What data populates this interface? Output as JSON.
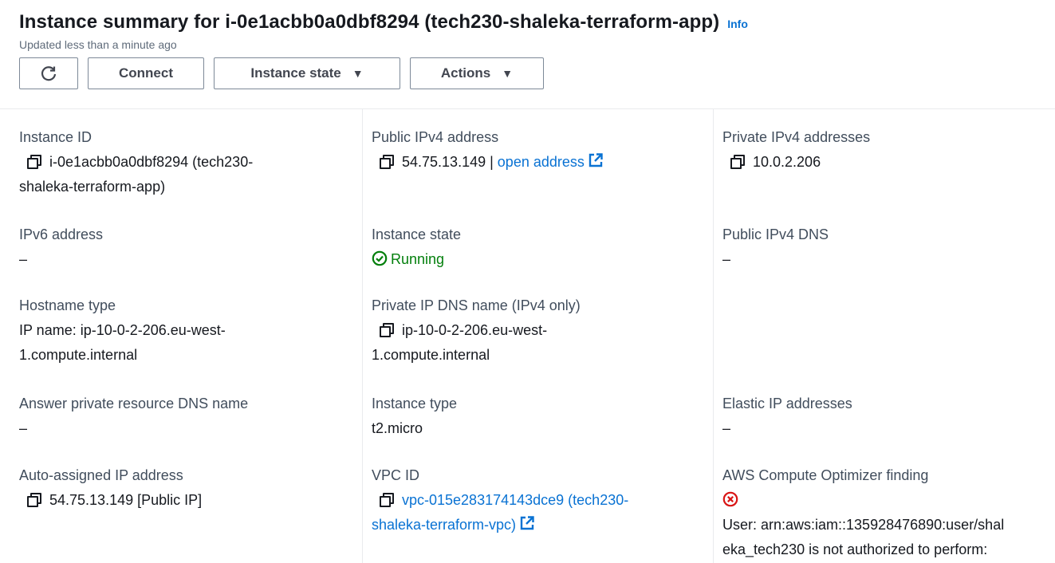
{
  "header": {
    "title": "Instance summary for i-0e1acbb0a0dbf8294 (tech230-shaleka-terraform-app)",
    "info": "Info",
    "updated": "Updated less than a minute ago"
  },
  "toolbar": {
    "refresh_icon": "refresh-icon",
    "connect": "Connect",
    "instance_state": "Instance state",
    "actions": "Actions"
  },
  "details": {
    "instance_id": {
      "label": "Instance ID",
      "line1": "i-0e1acbb0a0dbf8294 (tech230-",
      "line2": "shaleka-terraform-app)"
    },
    "public_ipv4": {
      "label": "Public IPv4 address",
      "value": "54.75.13.149 |",
      "link": "open address"
    },
    "private_ipv4": {
      "label": "Private IPv4 addresses",
      "value": "10.0.2.206"
    },
    "ipv6": {
      "label": "IPv6 address",
      "value": "–"
    },
    "instance_state": {
      "label": "Instance state",
      "value": "Running"
    },
    "public_dns": {
      "label": "Public IPv4 DNS",
      "value": "–"
    },
    "hostname_type": {
      "label": "Hostname type",
      "line1": "IP name: ip-10-0-2-206.eu-west-",
      "line2": "1.compute.internal"
    },
    "private_dns": {
      "label": "Private IP DNS name (IPv4 only)",
      "line1": "ip-10-0-2-206.eu-west-",
      "line2": "1.compute.internal"
    },
    "answer_dns": {
      "label": "Answer private resource DNS name",
      "value": "–"
    },
    "instance_type": {
      "label": "Instance type",
      "value": "t2.micro"
    },
    "elastic_ip": {
      "label": "Elastic IP addresses",
      "value": "–"
    },
    "auto_ip": {
      "label": "Auto-assigned IP address",
      "value": "54.75.13.149 [Public IP]"
    },
    "vpc_id": {
      "label": "VPC ID",
      "line1": "vpc-015e283174143dce9 (tech230-",
      "line2": "shaleka-terraform-vpc)"
    },
    "optimizer": {
      "label": "AWS Compute Optimizer finding",
      "line1": "User: arn:aws:iam::135928476890:user/shal",
      "line2": "eka_tech230 is not authorized to perform:"
    }
  },
  "colors": {
    "link": "#0972d3",
    "success": "#037f0c",
    "error": "#d91515"
  }
}
